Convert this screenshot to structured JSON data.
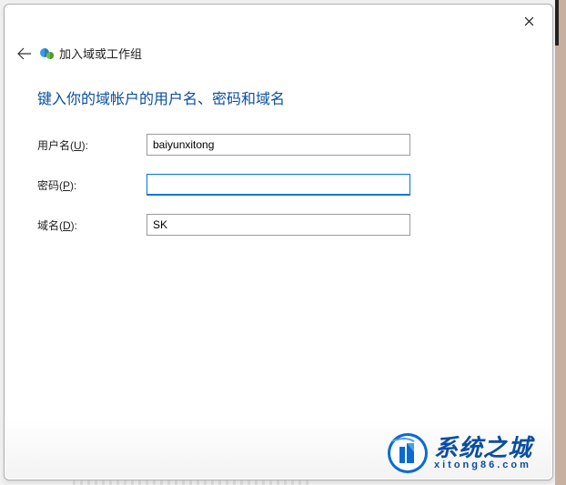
{
  "window": {
    "title": "加入域或工作组"
  },
  "heading": "键入你的域帐户的用户名、密码和域名",
  "form": {
    "username": {
      "label_pre": "用户名(",
      "hotkey": "U",
      "label_post": "):",
      "value": "baiyunxitong"
    },
    "password": {
      "label_pre": "密码(",
      "hotkey": "P",
      "label_post": "):",
      "value": ""
    },
    "domain": {
      "label_pre": "域名(",
      "hotkey": "D",
      "label_post": "):",
      "value": "SK"
    }
  },
  "watermark": {
    "main": "系统之城",
    "sub": "xitong86.com"
  }
}
